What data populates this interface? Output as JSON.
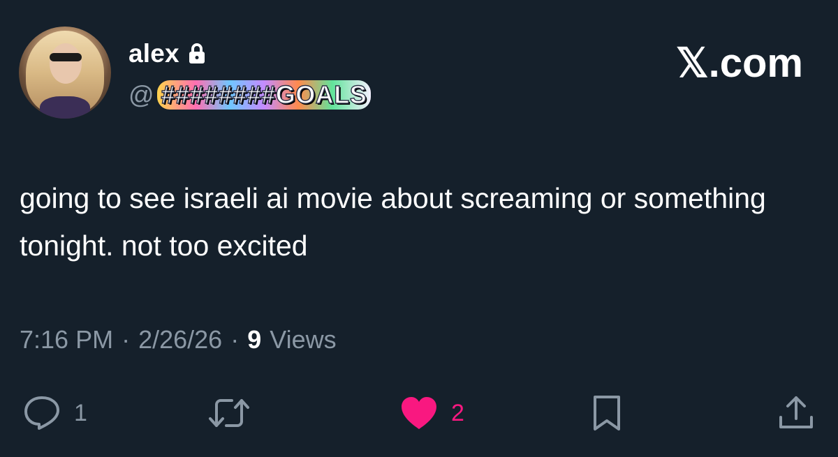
{
  "tweet": {
    "display_name": "alex",
    "handle_prefix": "@",
    "handle": "########GOALS",
    "brand": "𝕏.com",
    "text": "going to see israeli ai movie about screaming or something tonight. not too excited",
    "time": "7:16 PM",
    "date": "2/26/26",
    "separator": "·",
    "views_count": "9",
    "views_label": "Views"
  },
  "actions": {
    "reply_count": "1",
    "like_count": "2"
  },
  "colors": {
    "background": "#15202b",
    "muted_text": "#8b98a5",
    "like_pink": "#f91880"
  },
  "icons": {
    "lock": "lock-icon",
    "reply": "reply-icon",
    "retweet": "retweet-icon",
    "like": "heart-icon",
    "bookmark": "bookmark-icon",
    "share": "share-icon"
  }
}
